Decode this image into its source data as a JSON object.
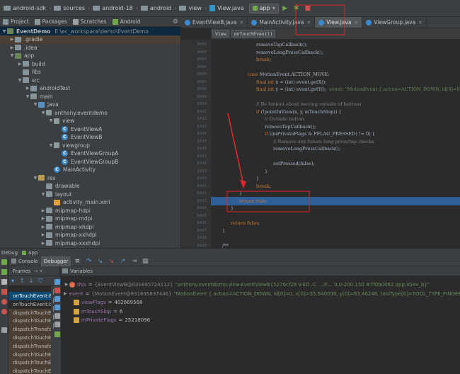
{
  "nav_bar": {
    "crumbs": [
      "android-sdk",
      "sources",
      "android-18",
      "android",
      "view",
      "View.java"
    ],
    "run_config": "app"
  },
  "project_panel": {
    "tabs": [
      "Project",
      "Packages",
      "Scratches",
      "Android"
    ],
    "tree": [
      {
        "label": "EventDemo",
        "hint": "E:\\ec_workspace\\demo\\EventDemo",
        "depth": 0,
        "arrow": "▼",
        "icon": "mod",
        "state": "sel"
      },
      {
        "label": ".gradle",
        "depth": 1,
        "arrow": "▶",
        "icon": "folder",
        "state": "hl"
      },
      {
        "label": ".idea",
        "depth": 1,
        "arrow": "▶",
        "icon": "folder"
      },
      {
        "label": "app",
        "depth": 1,
        "arrow": "▼",
        "icon": "mod"
      },
      {
        "label": "build",
        "depth": 2,
        "arrow": "▶",
        "icon": "folder"
      },
      {
        "label": "libs",
        "depth": 2,
        "arrow": "",
        "icon": "folder"
      },
      {
        "label": "src",
        "depth": 2,
        "arrow": "▼",
        "icon": "folder"
      },
      {
        "label": "androidTest",
        "depth": 3,
        "arrow": "▶",
        "icon": "folder"
      },
      {
        "label": "main",
        "depth": 3,
        "arrow": "▼",
        "icon": "folder"
      },
      {
        "label": "java",
        "depth": 4,
        "arrow": "▼",
        "icon": "src"
      },
      {
        "label": "anthony.eventdemo",
        "depth": 5,
        "arrow": "▼",
        "icon": "pkg"
      },
      {
        "label": "view",
        "depth": 6,
        "arrow": "▼",
        "icon": "pkg"
      },
      {
        "label": "EventViewA",
        "depth": 7,
        "arrow": "",
        "icon": "cls"
      },
      {
        "label": "EventViewB",
        "depth": 7,
        "arrow": "",
        "icon": "cls"
      },
      {
        "label": "viewgroup",
        "depth": 6,
        "arrow": "▼",
        "icon": "pkg"
      },
      {
        "label": "EventViewGroupA",
        "depth": 7,
        "arrow": "",
        "icon": "cls"
      },
      {
        "label": "EventViewGroupB",
        "depth": 7,
        "arrow": "",
        "icon": "cls"
      },
      {
        "label": "MainActivity",
        "depth": 6,
        "arrow": "",
        "icon": "cls"
      },
      {
        "label": "res",
        "depth": 4,
        "arrow": "▼",
        "icon": "res"
      },
      {
        "label": "drawable",
        "depth": 5,
        "arrow": "",
        "icon": "folder"
      },
      {
        "label": "layout",
        "depth": 5,
        "arrow": "▼",
        "icon": "folder"
      },
      {
        "label": "activity_main.xml",
        "depth": 6,
        "arrow": "",
        "icon": "xml"
      },
      {
        "label": "mipmap-hdpi",
        "depth": 5,
        "arrow": "▶",
        "icon": "folder"
      },
      {
        "label": "mipmap-mdpi",
        "depth": 5,
        "arrow": "▶",
        "icon": "folder"
      },
      {
        "label": "mipmap-xhdpi",
        "depth": 5,
        "arrow": "▶",
        "icon": "folder"
      },
      {
        "label": "mipmap-xxhdpi",
        "depth": 5,
        "arrow": "▶",
        "icon": "folder"
      },
      {
        "label": "mipmap-xxxhdpi",
        "depth": 5,
        "arrow": "▶",
        "icon": "folder"
      }
    ]
  },
  "editor_tabs": [
    {
      "label": "EventViewB.java",
      "active": false
    },
    {
      "label": "MainActivity.java",
      "active": false
    },
    {
      "label": "View.java",
      "active": true
    },
    {
      "label": "ViewGroup.java",
      "active": false
    }
  ],
  "editor_breadcrumb": [
    "View",
    "onTouchEvent()"
  ],
  "line_numbers": [
    "8402",
    "8403",
    "8404",
    "8405",
    "8406",
    "8407",
    "8408",
    "8409",
    "8410",
    "8411",
    "8412",
    "8413",
    "8414",
    "8415",
    "8416",
    "8417",
    "8418",
    "8419",
    "8420",
    "8421",
    "8422",
    "8423",
    "8424",
    "8425",
    "8426",
    "8427",
    "8428",
    "8429"
  ],
  "code_lines": [
    {
      "indent": 10,
      "text": "removeTapCallback();"
    },
    {
      "indent": 10,
      "text": "removeLongPressCallback();"
    },
    {
      "indent": 10,
      "kw": "break",
      "text": ";"
    },
    {
      "indent": 0,
      "text": ""
    },
    {
      "indent": 8,
      "kw": "case",
      "text": " MotionEvent.ACTION_MOVE:"
    },
    {
      "indent": 10,
      "kw": "final int",
      "text": " x = (int) event.getX();"
    },
    {
      "indent": 10,
      "kw": "final int",
      "text": " y = (int) event.getY();",
      "hint": "  event: \"MotionEvent { action=ACTION_DOWN, id[0]=0"
    },
    {
      "indent": 0,
      "text": ""
    },
    {
      "indent": 10,
      "comment": "// Be lenient about moving outside of buttons"
    },
    {
      "indent": 10,
      "kw": "if",
      "text": " (!pointInView(x, y, mTouchSlop)) {"
    },
    {
      "indent": 12,
      "comment": "// Outside button"
    },
    {
      "indent": 12,
      "text": "removeTapCallback();"
    },
    {
      "indent": 12,
      "kw": "if",
      "text": " ((mPrivateFlags & PFLAG_PRESSED) != 0) {"
    },
    {
      "indent": 14,
      "comment": "// Remove any future long press/tap checks"
    },
    {
      "indent": 14,
      "text": "removeLongPressCallback();"
    },
    {
      "indent": 0,
      "text": ""
    },
    {
      "indent": 14,
      "text": "setPressed(false);"
    },
    {
      "indent": 12,
      "text": "}"
    },
    {
      "indent": 10,
      "text": "}"
    },
    {
      "indent": 10,
      "kw": "break",
      "text": ";"
    },
    {
      "indent": 6,
      "text": "}"
    },
    {
      "indent": 6,
      "kw": "return true",
      "text": ";",
      "exec": true
    },
    {
      "indent": 4,
      "text": "}"
    },
    {
      "indent": 0,
      "text": ""
    },
    {
      "indent": 4,
      "kw": "return false",
      "text": ";"
    },
    {
      "indent": 2,
      "text": "}"
    },
    {
      "indent": 0,
      "text": ""
    },
    {
      "indent": 2,
      "text": "/**"
    }
  ],
  "debug": {
    "title": "Debug",
    "config": "app",
    "tabs": [
      "Console",
      "Debugger"
    ],
    "frames_label": "Frames",
    "variables_label": "Variables",
    "frames": [
      {
        "label": "onTouchEvent:8",
        "state": "sel"
      },
      {
        "label": "onTouchEvent:b",
        "state": ""
      },
      {
        "label": "dispatchTouchEv",
        "state": "lib"
      },
      {
        "label": "dispatchTouchEv",
        "state": "lib"
      },
      {
        "label": "dispatchTransfo",
        "state": "lib"
      },
      {
        "label": "dispatchTouchEv",
        "state": "lib"
      },
      {
        "label": "dispatchTransfo",
        "state": "lib"
      },
      {
        "label": "dispatchTouchEv",
        "state": "lib"
      },
      {
        "label": "dispatchTouchEv",
        "state": "lib"
      },
      {
        "label": "dispatchTouchEv",
        "state": "lib"
      }
    ],
    "variables": [
      {
        "name": "this",
        "type": "{EventViewB@831695724112}",
        "value": "\"anthony.eventdemo.view.EventViewB{5276cf28 V.ED..C. ...P.... 0,0-200,150 #7f0b0062 app:id/ev_b}\"",
        "kind": "obj",
        "expand": true
      },
      {
        "name": "event",
        "type": "{MotionEvent@831695837448}",
        "value": "\"MotionEvent { action=ACTION_DOWN, id[0]=0, x[0]=35.940098, y[0]=83.46246, toolType[0]=TOOL_TYPE_FINGER, buttonState=\"",
        "kind": "obj",
        "expand": true
      },
      {
        "name": "viewFlags",
        "type": "",
        "value": "402669568",
        "kind": "fld",
        "expand": false
      },
      {
        "name": "mTouchSlop",
        "type": "",
        "value": "6",
        "kind": "fld",
        "expand": false
      },
      {
        "name": "mPrivateFlags",
        "type": "",
        "value": "25218096",
        "kind": "fld",
        "expand": false
      }
    ]
  },
  "colors": {
    "bg": "#2b2b2b",
    "panel": "#3c3f41",
    "exec_line": "#2d6099",
    "annotation_red": "#e0262b",
    "keyword": "#cc7832"
  }
}
